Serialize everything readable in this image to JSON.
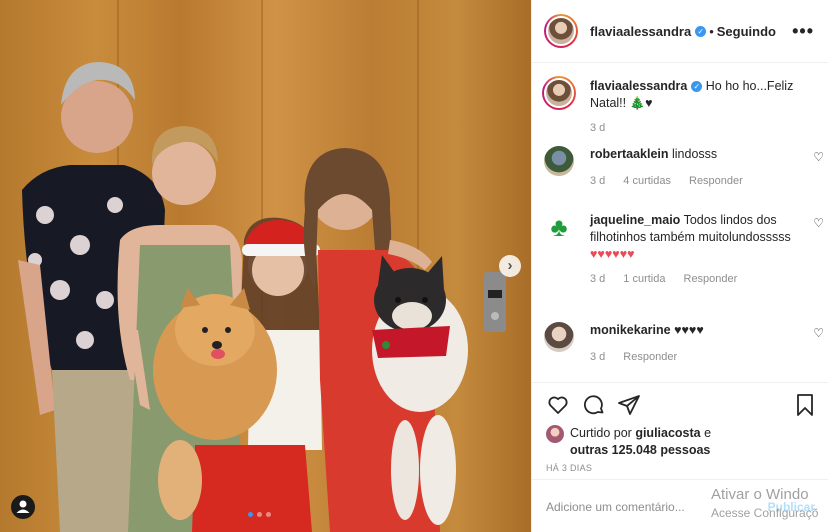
{
  "post": {
    "username": "flaviaalessandra",
    "follow_status": "Seguindo",
    "caption_user": "flaviaalessandra",
    "caption_text": "Ho ho ho...Feliz Natal!! 🎄♥",
    "caption_time": "3 d"
  },
  "comments": [
    {
      "user": "robertaaklein",
      "text": "lindosss",
      "time": "3 d",
      "likes": "4 curtidas",
      "reply": "Responder"
    },
    {
      "user": "jaqueline_maio",
      "text": "Todos lindos dos filhotinhos também muitolundosssss",
      "hearts": "♥♥♥♥♥♥",
      "time": "3 d",
      "likes": "1 curtida",
      "reply": "Responder"
    },
    {
      "user": "monikekarine",
      "text": "♥♥♥♥",
      "time": "3 d",
      "reply": "Responder"
    }
  ],
  "likes": {
    "prefix": "Curtido por",
    "user": "giuliacosta",
    "conj": "e",
    "others": "outras 125.048 pessoas"
  },
  "posted_ago": "HÁ 3 DIAS",
  "add_comment": {
    "placeholder": "Adicione um comentário...",
    "publish": "Publicar"
  },
  "windows_watermark": {
    "line1": "Ativar o Windo",
    "line2": "Acesse Configuraçõ"
  },
  "icons": [
    "more-options-icon",
    "verified-badge-icon",
    "heart-icon",
    "comment-icon",
    "share-icon",
    "bookmark-icon",
    "next-arrow-icon",
    "tag-user-icon"
  ],
  "carousel": {
    "count": 3,
    "active": 1
  },
  "colors": {
    "verified": "#3897f0",
    "link": "#b2dffc",
    "heart_red": "#ed4956",
    "meta": "#8e8e8e"
  }
}
